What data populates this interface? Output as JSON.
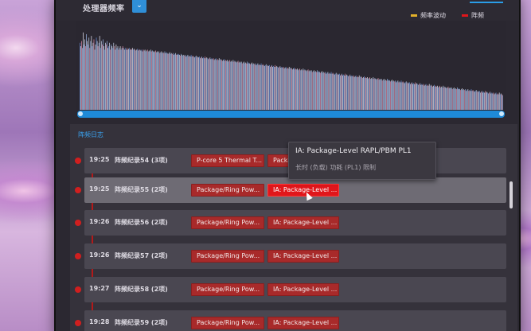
{
  "header": {
    "title": "处理器频率",
    "select_icon": "chevron-down-icon",
    "select_glyph": "⌄"
  },
  "legend": [
    {
      "label": "频率波动",
      "color": "#e3b12a"
    },
    {
      "label": "阵频",
      "color": "#e0161b"
    }
  ],
  "chart_data": {
    "type": "bar",
    "title": "处理器频率",
    "xlabel": "",
    "ylabel": "",
    "series": [
      {
        "name": "频率波动",
        "color": "#e3b12a"
      },
      {
        "name": "阵频",
        "color": "#e0161b"
      }
    ],
    "bar_colors": [
      "#6a8ed6",
      "#c9d6ee",
      "#d98aa8",
      "#9bb6e6",
      "#e6e3ef"
    ],
    "values": [
      0.78,
      0.74,
      0.8,
      0.72,
      0.9,
      0.76,
      0.82,
      0.74,
      0.88,
      0.8,
      0.76,
      0.84,
      0.72,
      0.8,
      0.86,
      0.74,
      0.78,
      0.82,
      0.7,
      0.76,
      0.84,
      0.8,
      0.74,
      0.78,
      0.86,
      0.72,
      0.8,
      0.76,
      0.82,
      0.74,
      0.7,
      0.78,
      0.76,
      0.8,
      0.72,
      0.74,
      0.78,
      0.7,
      0.76,
      0.74,
      0.72,
      0.78,
      0.74,
      0.7,
      0.76,
      0.72,
      0.74,
      0.7,
      0.72,
      0.74,
      0.7,
      0.72,
      0.74,
      0.72,
      0.7,
      0.72,
      0.7,
      0.72,
      0.7,
      0.71,
      0.72,
      0.7,
      0.71,
      0.7,
      0.72,
      0.7,
      0.71,
      0.7,
      0.69,
      0.7,
      0.71,
      0.69,
      0.7,
      0.7,
      0.69,
      0.7,
      0.68,
      0.7,
      0.69,
      0.7,
      0.68,
      0.69,
      0.7,
      0.68,
      0.69,
      0.68,
      0.7,
      0.68,
      0.69,
      0.68,
      0.67,
      0.68,
      0.69,
      0.67,
      0.68,
      0.67,
      0.68,
      0.66,
      0.67,
      0.68,
      0.66,
      0.67,
      0.66,
      0.68,
      0.66,
      0.67,
      0.66,
      0.65,
      0.66,
      0.67,
      0.65,
      0.66,
      0.65,
      0.66,
      0.64,
      0.65,
      0.66,
      0.64,
      0.65,
      0.64,
      0.65,
      0.64,
      0.63,
      0.65,
      0.64,
      0.63,
      0.64,
      0.63,
      0.64,
      0.62,
      0.63,
      0.64,
      0.62,
      0.63,
      0.62,
      0.64,
      0.62,
      0.63,
      0.62,
      0.61,
      0.62,
      0.63,
      0.61,
      0.62,
      0.61,
      0.62,
      0.6,
      0.61,
      0.62,
      0.6,
      0.61,
      0.6,
      0.62,
      0.6,
      0.61,
      0.6,
      0.59,
      0.6,
      0.61,
      0.59,
      0.6,
      0.59,
      0.6,
      0.58,
      0.59,
      0.6,
      0.58,
      0.59,
      0.58,
      0.6,
      0.58,
      0.59,
      0.58,
      0.57,
      0.58,
      0.59,
      0.57,
      0.58,
      0.57,
      0.58,
      0.56,
      0.57,
      0.58,
      0.56,
      0.57,
      0.56,
      0.58,
      0.56,
      0.57,
      0.56,
      0.55,
      0.56,
      0.57,
      0.55,
      0.56,
      0.55,
      0.56,
      0.54,
      0.55,
      0.56,
      0.54,
      0.55,
      0.54,
      0.56,
      0.54,
      0.55,
      0.54,
      0.53,
      0.54,
      0.55,
      0.53,
      0.54,
      0.53,
      0.54,
      0.52,
      0.53,
      0.54,
      0.52,
      0.53,
      0.52,
      0.54,
      0.52,
      0.53,
      0.52,
      0.51,
      0.52,
      0.53,
      0.51,
      0.52,
      0.51,
      0.52,
      0.5,
      0.51,
      0.52,
      0.5,
      0.51,
      0.5,
      0.52,
      0.5,
      0.51,
      0.5,
      0.49,
      0.5,
      0.51,
      0.49,
      0.5,
      0.49,
      0.5,
      0.48,
      0.49,
      0.5,
      0.48,
      0.49,
      0.48,
      0.5,
      0.48,
      0.49,
      0.48,
      0.47,
      0.48,
      0.49,
      0.47,
      0.48,
      0.47,
      0.48,
      0.46,
      0.47,
      0.48,
      0.46,
      0.47,
      0.46,
      0.48,
      0.46,
      0.47,
      0.46,
      0.45,
      0.46,
      0.47,
      0.45,
      0.46,
      0.45,
      0.46,
      0.44,
      0.45,
      0.46,
      0.44,
      0.45,
      0.44,
      0.46,
      0.44,
      0.45,
      0.44,
      0.43,
      0.44,
      0.45,
      0.43,
      0.44,
      0.43,
      0.44,
      0.42,
      0.43,
      0.44,
      0.42,
      0.43,
      0.42,
      0.44,
      0.42,
      0.43,
      0.42,
      0.41,
      0.42,
      0.43,
      0.41,
      0.42,
      0.41,
      0.42,
      0.4,
      0.41,
      0.42,
      0.4,
      0.41,
      0.4,
      0.42,
      0.4,
      0.41,
      0.4,
      0.39,
      0.4,
      0.41,
      0.39,
      0.4,
      0.39,
      0.4,
      0.38,
      0.39,
      0.4,
      0.38,
      0.39,
      0.38,
      0.4,
      0.38,
      0.39,
      0.38,
      0.37,
      0.38,
      0.39,
      0.37,
      0.38,
      0.37,
      0.38,
      0.36,
      0.37,
      0.38,
      0.36,
      0.37,
      0.36,
      0.38,
      0.36,
      0.37,
      0.36,
      0.35,
      0.36,
      0.37,
      0.35,
      0.36,
      0.35,
      0.36,
      0.34,
      0.35,
      0.36,
      0.34,
      0.35,
      0.34,
      0.36,
      0.34,
      0.35,
      0.34,
      0.33,
      0.34,
      0.35,
      0.33,
      0.34,
      0.33,
      0.34,
      0.32,
      0.33,
      0.34,
      0.32,
      0.33,
      0.32,
      0.34,
      0.32,
      0.33,
      0.32,
      0.31,
      0.32,
      0.33,
      0.31,
      0.32,
      0.31,
      0.32,
      0.3,
      0.31,
      0.32,
      0.3,
      0.31,
      0.3,
      0.32,
      0.3,
      0.31,
      0.3,
      0.29,
      0.3,
      0.31,
      0.29,
      0.3,
      0.29,
      0.3,
      0.28,
      0.29,
      0.3,
      0.28,
      0.29,
      0.28,
      0.3,
      0.28,
      0.29,
      0.28,
      0.27,
      0.28,
      0.29,
      0.27,
      0.28,
      0.27,
      0.28,
      0.26,
      0.27,
      0.28,
      0.26,
      0.27,
      0.26,
      0.28,
      0.26,
      0.27,
      0.26,
      0.25,
      0.26,
      0.27,
      0.25,
      0.26,
      0.25,
      0.26,
      0.24,
      0.25,
      0.26,
      0.24,
      0.25,
      0.24,
      0.26,
      0.24,
      0.25,
      0.24,
      0.23,
      0.24,
      0.25,
      0.23,
      0.24,
      0.23,
      0.24,
      0.22,
      0.23,
      0.24,
      0.22,
      0.23,
      0.22,
      0.24,
      0.22,
      0.23,
      0.22,
      0.21,
      0.22,
      0.23,
      0.21,
      0.22,
      0.21,
      0.22,
      0.2,
      0.21,
      0.22,
      0.2,
      0.21,
      0.2,
      0.22,
      0.2,
      0.21,
      0.2,
      0.19,
      0.2,
      0.21,
      0.19,
      0.2,
      0.19,
      0.2,
      0.18,
      0.19,
      0.2,
      0.18,
      0.19,
      0.18,
      0.2,
      0.18,
      0.19,
      0.18,
      0.17
    ],
    "ylim": [
      0,
      1
    ],
    "grid": false,
    "legend_position": "top-right"
  },
  "log": {
    "title": "阵频日志",
    "rows": [
      {
        "time": "19:25",
        "label": "阵频纪录54 (3项)",
        "tags": [
          "P-core 5 Thermal T...",
          "Packa"
        ]
      },
      {
        "time": "19:25",
        "label": "阵频纪录55 (2项)",
        "tags": [
          "Package/Ring Pow...",
          "IA: Package-Level ..."
        ]
      },
      {
        "time": "19:26",
        "label": "阵频纪录56 (2项)",
        "tags": [
          "Package/Ring Pow...",
          "IA: Package-Level ..."
        ]
      },
      {
        "time": "19:26",
        "label": "阵频纪录57 (2项)",
        "tags": [
          "Package/Ring Pow...",
          "IA: Package-Level ..."
        ]
      },
      {
        "time": "19:27",
        "label": "阵频纪录58 (2项)",
        "tags": [
          "Package/Ring Pow...",
          "IA: Package-Level ..."
        ]
      },
      {
        "time": "19:28",
        "label": "阵频纪录59 (2项)",
        "tags": [
          "Package/Ring Pow...",
          "IA: Package-Level ..."
        ]
      }
    ]
  },
  "tooltip": {
    "title": "IA: Package-Level RAPL/PBM PL1",
    "subtitle": "长时 (负载) 功耗 (PL1) 限制"
  }
}
